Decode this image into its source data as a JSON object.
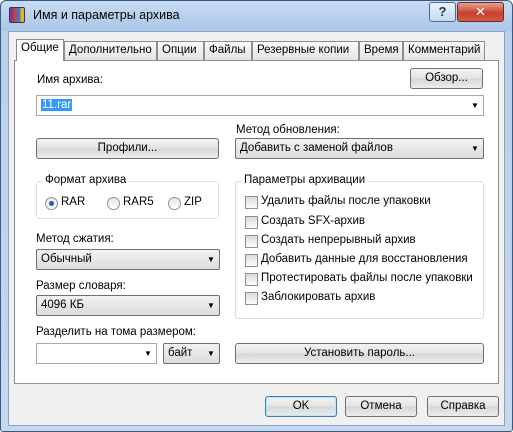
{
  "window": {
    "title": "Имя и параметры архива",
    "help_label": "?",
    "close_label": "✕"
  },
  "tabs": [
    {
      "label": "Общие",
      "active": true
    },
    {
      "label": "Дополнительно"
    },
    {
      "label": "Опции"
    },
    {
      "label": "Файлы"
    },
    {
      "label": "Резервные копии"
    },
    {
      "label": "Время"
    },
    {
      "label": "Комментарий"
    }
  ],
  "archive": {
    "name_label": "Имя архива:",
    "name_value": "11.rar",
    "browse_label": "Обзор..."
  },
  "profiles_label": "Профили...",
  "update_method": {
    "label": "Метод обновления:",
    "value": "Добавить с заменой файлов"
  },
  "format": {
    "label": "Формат архива",
    "options": [
      {
        "label": "RAR",
        "selected": true
      },
      {
        "label": "RAR5",
        "selected": false
      },
      {
        "label": "ZIP",
        "selected": false
      }
    ]
  },
  "compression": {
    "label": "Метод сжатия:",
    "value": "Обычный"
  },
  "dictionary": {
    "label": "Размер словаря:",
    "value": "4096 КБ"
  },
  "split": {
    "label": "Разделить на тома размером:",
    "value": "",
    "unit": "байт"
  },
  "options": {
    "label": "Параметры архивации",
    "items": [
      {
        "label": "Удалить файлы после упаковки",
        "checked": false
      },
      {
        "label": "Создать SFX-архив",
        "checked": false
      },
      {
        "label": "Создать непрерывный архив",
        "checked": false
      },
      {
        "label": "Добавить данные для восстановления",
        "checked": false
      },
      {
        "label": "Протестировать файлы после упаковки",
        "checked": false
      },
      {
        "label": "Заблокировать архив",
        "checked": false
      }
    ]
  },
  "password_label": "Установить пароль...",
  "buttons": {
    "ok": "OK",
    "cancel": "Отмена",
    "help": "Справка"
  },
  "icons": {
    "app": "winrar-books-icon",
    "dropdown": "chevron-down-icon"
  }
}
